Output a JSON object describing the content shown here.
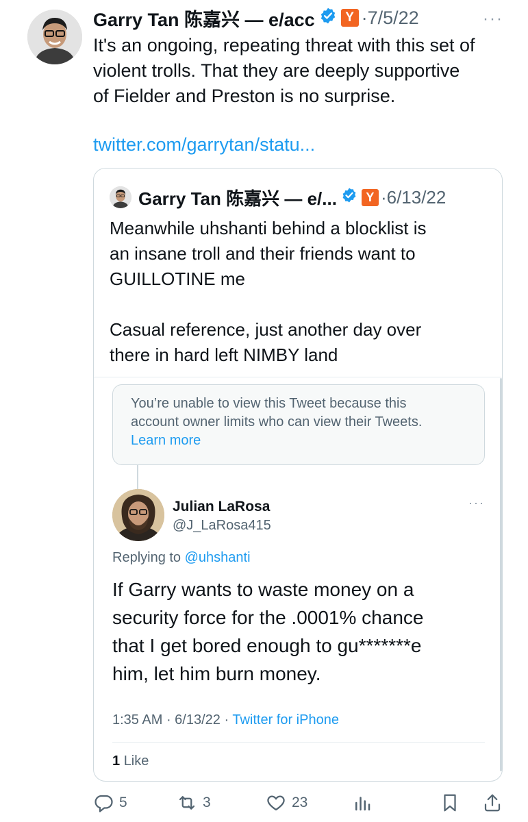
{
  "tweet": {
    "author_name": "Garry Tan 陈嘉兴 — e/acc",
    "yc_badge": "Y",
    "date": "7/5/22",
    "more": "···",
    "text_lines": [
      "It's an ongoing, repeating threat with this set of",
      "violent trolls. That they are deeply supportive",
      "of Fielder and Preston is no surprise."
    ],
    "link": "twitter.com/garrytan/statu..."
  },
  "quote": {
    "author_name": "Garry Tan 陈嘉兴 — e/...",
    "yc_badge": "Y",
    "date": "6/13/22",
    "para1_lines": [
      "Meanwhile uhshanti behind a blocklist is",
      "an insane troll and their friends want to",
      "GUILLOTINE me"
    ],
    "para2_lines": [
      "Casual reference, just another day over",
      "there in hard left NIMBY land"
    ]
  },
  "notice": {
    "line1": "You’re unable to view this Tweet because this",
    "line2": "account owner limits who can view their Tweets.",
    "learn_more": "Learn more"
  },
  "reply": {
    "name": "Julian LaRosa",
    "handle": "@J_LaRosa415",
    "more": "···",
    "replying_label": "Replying to",
    "replying_handle": "@uhshanti",
    "text_lines": [
      "If Garry wants to waste money on a",
      "security force for the .0001% chance",
      "that I get bored enough to gu*******e",
      "him, let him burn money."
    ],
    "time": "1:35 AM",
    "date": "6/13/22",
    "source": "Twitter for iPhone",
    "likes_count": "1",
    "likes_label": "Like"
  },
  "actions": {
    "replies": "5",
    "retweets": "3",
    "likes": "23"
  },
  "colors": {
    "link": "#1d9bf0",
    "verified": "#1d9bf0",
    "yc": "#f26522",
    "muted": "#536471"
  },
  "icons": [
    "verified-badge-icon",
    "yc-badge-icon",
    "reply-icon",
    "retweet-icon",
    "like-icon",
    "views-icon",
    "bookmark-icon",
    "share-icon"
  ]
}
